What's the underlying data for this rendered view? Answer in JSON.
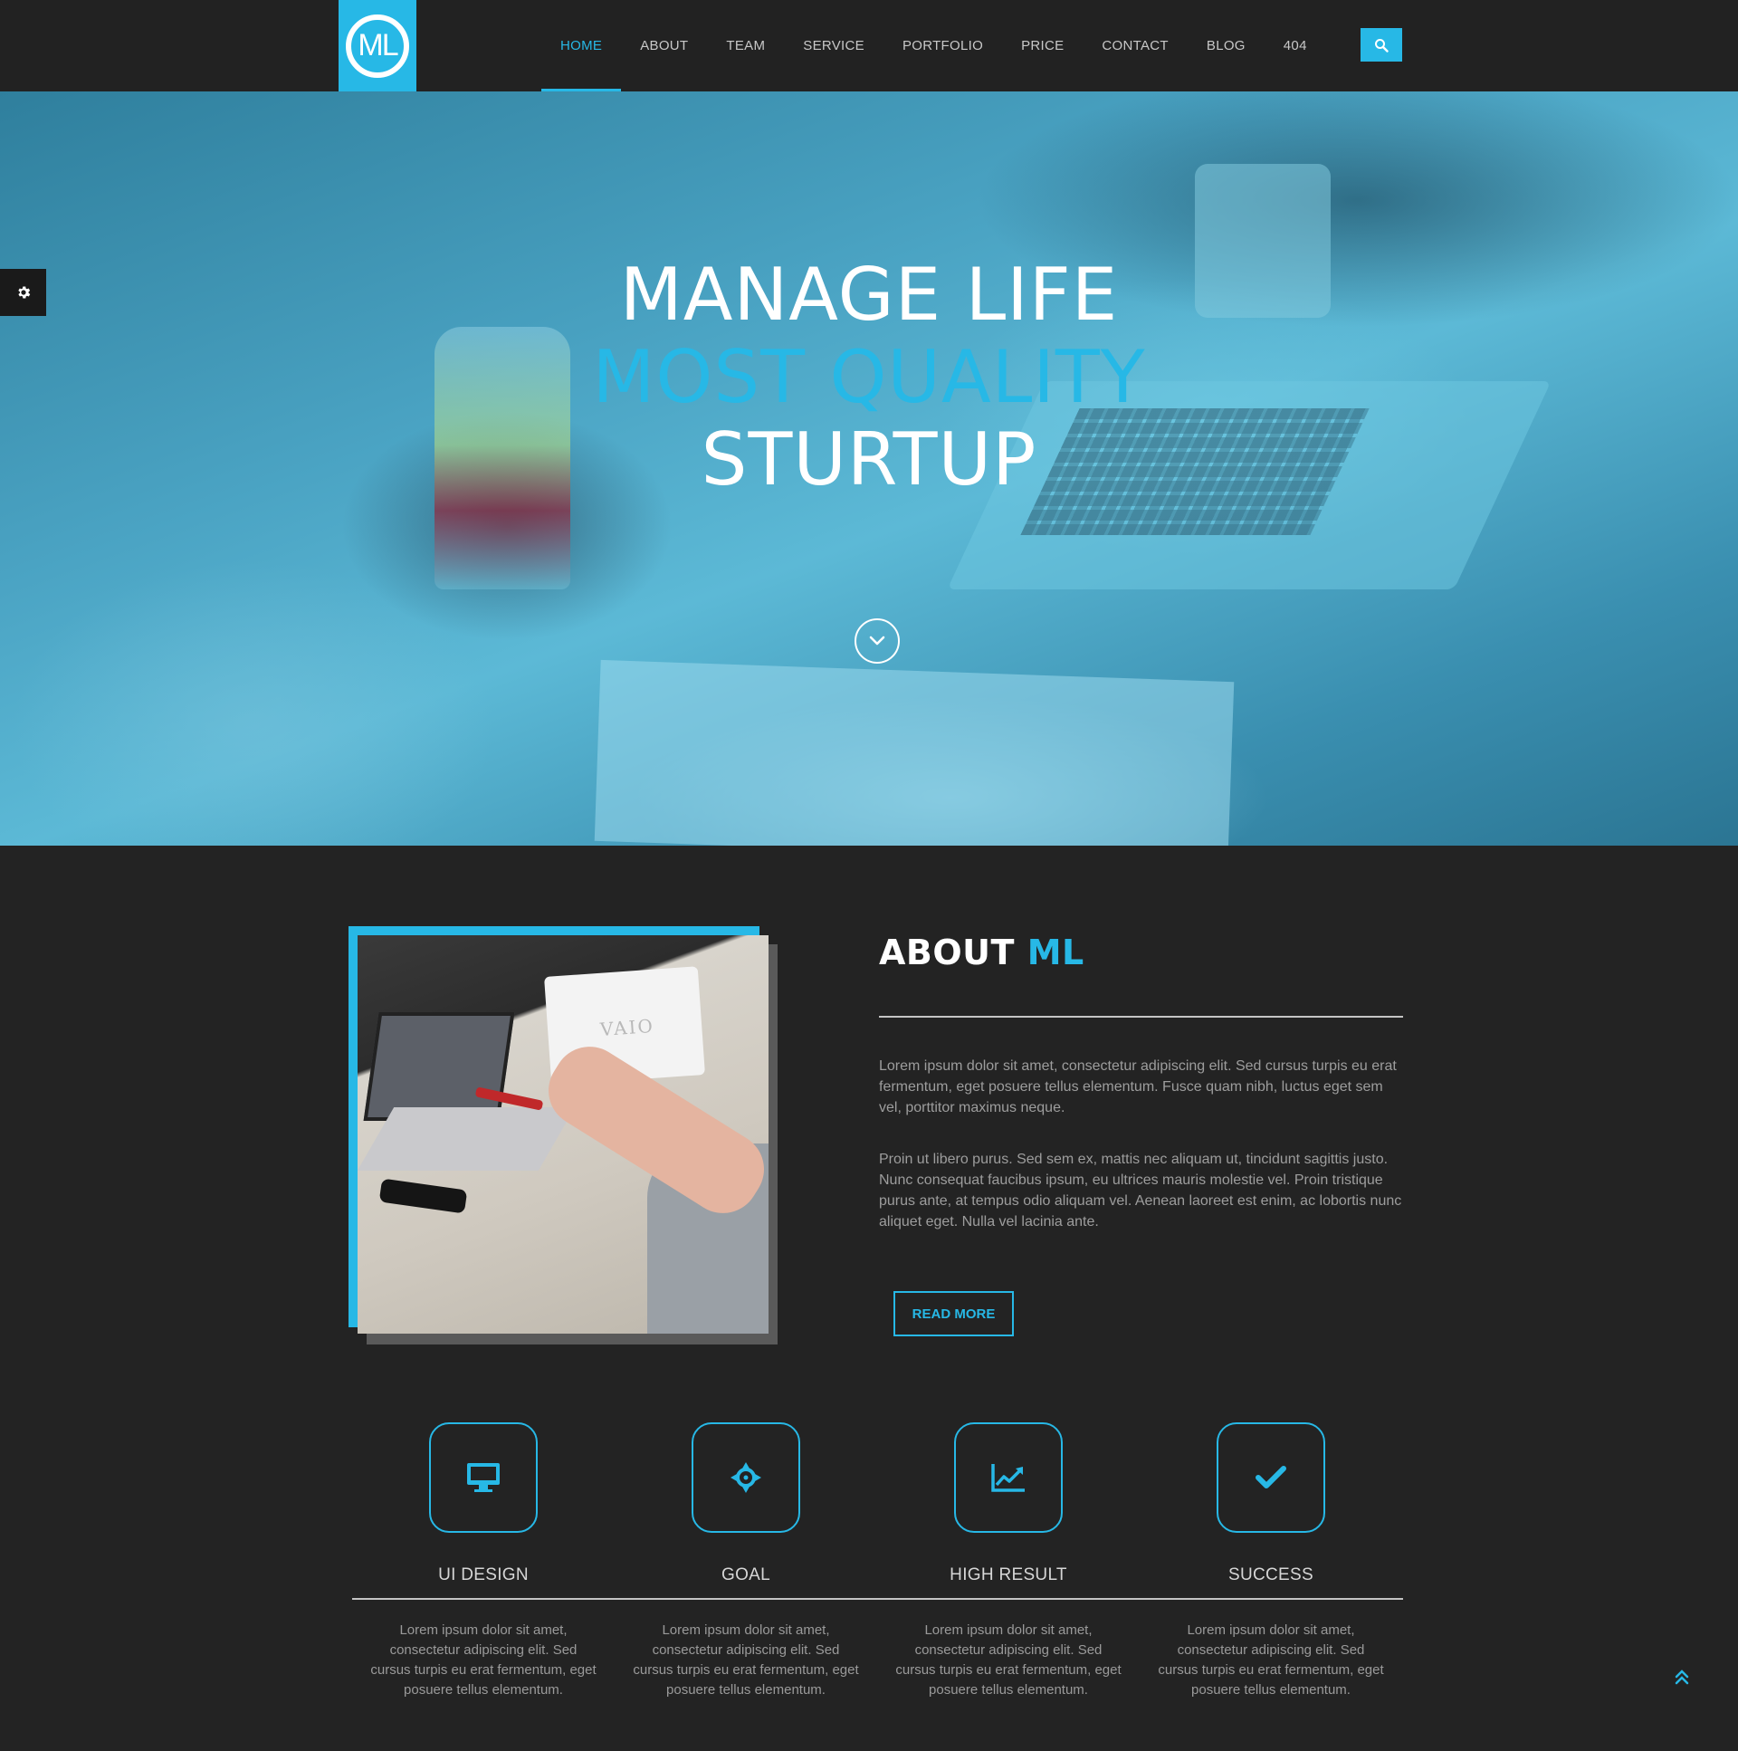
{
  "colors": {
    "accent": "#27b8e6",
    "background": "#232323",
    "header": "#222222"
  },
  "header": {
    "logo_text": "ML",
    "nav": [
      {
        "label": "HOME",
        "active": true
      },
      {
        "label": "ABOUT"
      },
      {
        "label": "TEAM"
      },
      {
        "label": "SERVICE"
      },
      {
        "label": "PORTFOLIO"
      },
      {
        "label": "PRICE"
      },
      {
        "label": "CONTACT"
      },
      {
        "label": "BLOG"
      },
      {
        "label": "404"
      }
    ],
    "search_icon": "search-icon"
  },
  "hero": {
    "line1": "MANAGE LIFE",
    "line2": "MOST QUALITY",
    "line3": "STURTUP",
    "scroll_icon": "chevron-down-icon",
    "settings_icon": "gear-icon"
  },
  "about": {
    "title_main": "ABOUT",
    "title_accent": "ML",
    "image_label": "VAIO",
    "paragraph1": "Lorem ipsum dolor sit amet, consectetur adipiscing elit. Sed cursus turpis eu erat fermentum, eget posuere tellus elementum. Fusce quam nibh, luctus eget sem vel, porttitor maximus neque.",
    "paragraph2": "Proin ut libero purus. Sed sem ex, mattis nec aliquam ut, tincidunt sagittis justo. Nunc consequat faucibus ipsum, eu ultrices mauris molestie vel. Proin tristique purus ante, at tempus odio aliquam vel. Aenean laoreet est enim, ac lobortis nunc aliquet eget. Nulla vel lacinia ante.",
    "button": "READ MORE"
  },
  "features": [
    {
      "icon": "monitor-icon",
      "title": "UI DESIGN",
      "text": "Lorem ipsum dolor sit amet, consectetur adipiscing elit. Sed cursus turpis eu erat fermentum, eget posuere tellus elementum."
    },
    {
      "icon": "crosshair-icon",
      "title": "GOAL",
      "text": "Lorem ipsum dolor sit amet, consectetur adipiscing elit. Sed cursus turpis eu erat fermentum, eget posuere tellus elementum."
    },
    {
      "icon": "chart-line-icon",
      "title": "HIGH RESULT",
      "text": "Lorem ipsum dolor sit amet, consectetur adipiscing elit. Sed cursus turpis eu erat fermentum, eget posuere tellus elementum."
    },
    {
      "icon": "checkmark-icon",
      "title": "SUCCESS",
      "text": "Lorem ipsum dolor sit amet, consectetur adipiscing elit. Sed cursus turpis eu erat fermentum, eget posuere tellus elementum."
    }
  ],
  "back_to_top_icon": "double-chevron-up-icon"
}
